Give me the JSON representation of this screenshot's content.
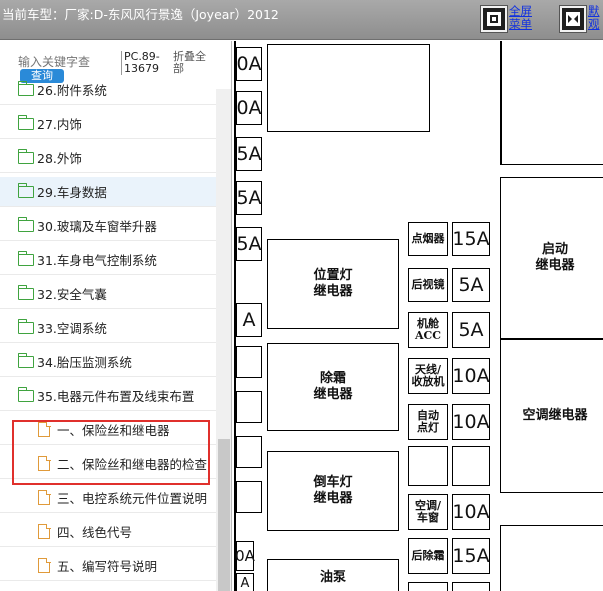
{
  "header": {
    "vehicle_label": "当前车型：厂家:D-东风风行景逸（Joyear）2012",
    "fullscreen_line1": "全屏",
    "fullscreen_line2": "菜单",
    "hidden_line1": "默",
    "hidden_line2": "观"
  },
  "sidebar": {
    "search_placeholder": "输入关键字查",
    "search_button": "查询",
    "pc_code": "PC.89-13679",
    "collapse_all": "折叠全部",
    "items": [
      {
        "label": "26.附件系统",
        "type": "folder"
      },
      {
        "label": "27.内饰",
        "type": "folder"
      },
      {
        "label": "28.外饰",
        "type": "folder"
      },
      {
        "label": "29.车身数据",
        "type": "folder"
      },
      {
        "label": "30.玻璃及车窗举升器",
        "type": "folder"
      },
      {
        "label": "31.车身电气控制系统",
        "type": "folder"
      },
      {
        "label": "32.安全气囊",
        "type": "folder"
      },
      {
        "label": "33.空调系统",
        "type": "folder"
      },
      {
        "label": "34.胎压监测系统",
        "type": "folder"
      },
      {
        "label": "35.电器元件布置及线束布置",
        "type": "folder"
      },
      {
        "label": "一、保险丝和继电器",
        "type": "doc"
      },
      {
        "label": "二、保险丝和继电器的检查",
        "type": "doc"
      },
      {
        "label": "三、电控系统元件位置说明",
        "type": "doc"
      },
      {
        "label": "四、线色代号",
        "type": "doc"
      },
      {
        "label": "五、编写符号说明",
        "type": "doc"
      }
    ]
  },
  "diagram": {
    "left_fuses": [
      "0A",
      "0A",
      "5A",
      "5A",
      "5A",
      "A"
    ],
    "left_fuses_bottom": [
      "0A",
      "A"
    ],
    "fuse_rows": [
      {
        "name": "点烟器",
        "amp": "15A"
      },
      {
        "name": "后视镜",
        "amp": "5A"
      },
      {
        "name": "机舱\nACC",
        "amp": "5A"
      },
      {
        "name": "天线/\n收放机",
        "amp": "10A"
      },
      {
        "name": "自动\n点灯",
        "amp": "10A"
      },
      {
        "name": "空调/\n车窗",
        "amp": "10A"
      },
      {
        "name": "后除霜",
        "amp": "15A"
      }
    ],
    "relays": {
      "position_lamp": "位置灯\n继电器",
      "defrost": "除霜\n继电器",
      "reverse_lamp": "倒车灯\n继电器",
      "start": "启动\n继电器",
      "ac": "空调继电器",
      "bottom_partial": "油泵"
    }
  }
}
